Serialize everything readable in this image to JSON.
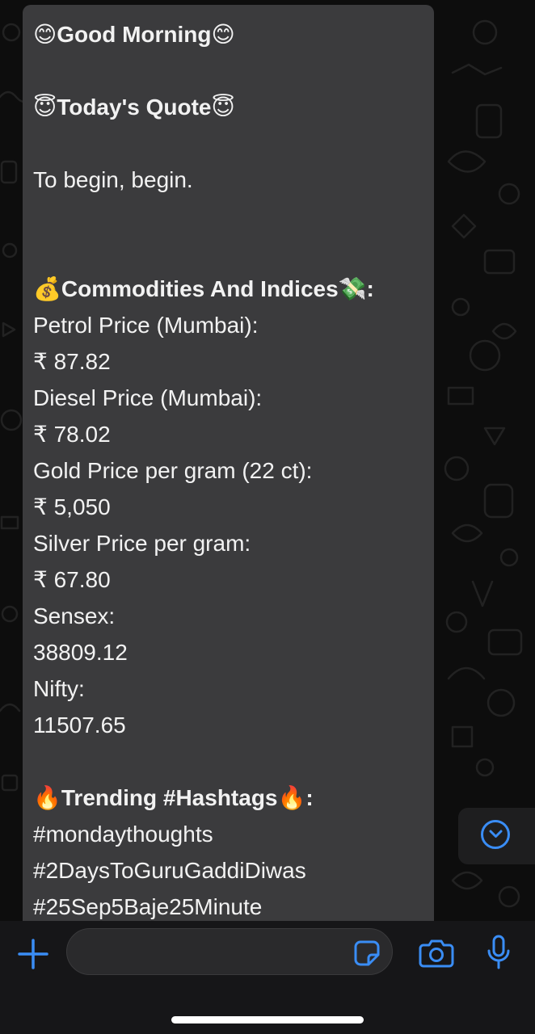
{
  "colors": {
    "bubble": "#3b3b3d",
    "accent": "#3a8df5",
    "background": "#0b0b0b",
    "text": "#f2f2f2"
  },
  "message": {
    "greeting": {
      "emoji_left": "😊",
      "text": "Good Morning",
      "emoji_right": "😊"
    },
    "quote_heading": {
      "emoji_left": "😇",
      "text": "Today's Quote",
      "emoji_right": "😇"
    },
    "quote": "To begin, begin.",
    "commodities_heading": {
      "emoji_left": "💰",
      "text": "Commodities And Indices",
      "emoji_right": "💸",
      "suffix": ":"
    },
    "commodities": [
      {
        "label": "Petrol Price (Mumbai):",
        "value": "₹ 87.82"
      },
      {
        "label": "Diesel Price (Mumbai):",
        "value": "₹ 78.02"
      },
      {
        "label": "Gold Price per gram (22 ct):",
        "value": "₹ 5,050"
      },
      {
        "label": "Silver Price per gram:",
        "value": "₹ 67.80"
      },
      {
        "label": "Sensex:",
        "value": "38809.12"
      },
      {
        "label": "Nifty:",
        "value": "11507.65"
      }
    ],
    "trending_heading": {
      "emoji_left": "🔥",
      "text": "Trending #Hashtags",
      "emoji_right": "🔥",
      "suffix": ":"
    },
    "hashtags": [
      "#mondaythoughts",
      "#2DaysToGuruGaddiDiwas",
      "#25Sep5Baje25Minute"
    ]
  },
  "input_bar": {
    "icons": [
      "plus-icon",
      "sticker-icon",
      "camera-icon",
      "microphone-icon"
    ],
    "placeholder": ""
  },
  "scroll_button_icon": "chevron-down-icon"
}
